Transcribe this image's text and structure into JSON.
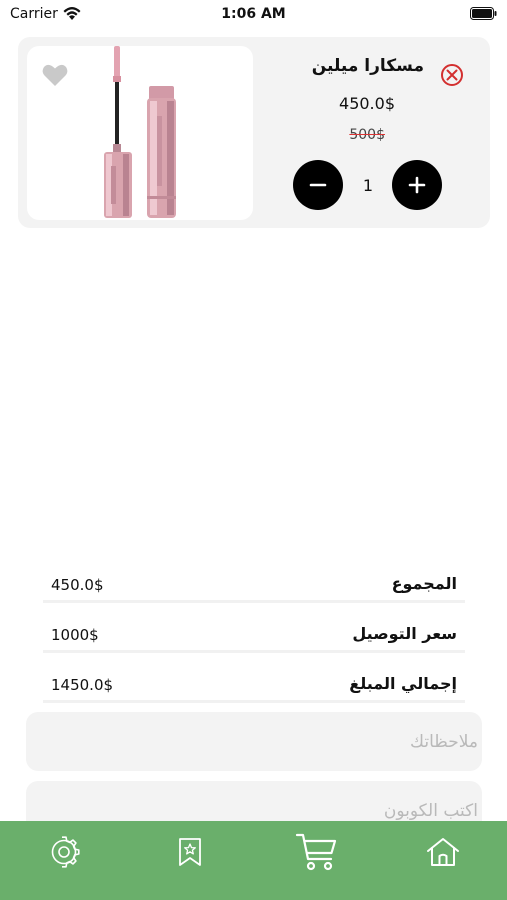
{
  "status_bar": {
    "carrier": "Carrier",
    "time": "1:06 AM"
  },
  "cart_item": {
    "name": "مسكارا ميلين",
    "price": "450.0$",
    "old_price_number": "500",
    "old_price_currency": "$",
    "quantity": "1",
    "favorite": false
  },
  "summary": {
    "subtotal_label": "المجموع",
    "subtotal_value": "450.0$",
    "delivery_label": "سعر التوصيل",
    "delivery_value": "1000$",
    "total_label": "إجمالي المبلغ",
    "total_value": "1450.0$"
  },
  "notes": {
    "placeholder": "ملاحظاتك",
    "value": ""
  },
  "coupon": {
    "placeholder": "اكتب الكوبون",
    "value": ""
  },
  "colors": {
    "nav_bar": "#6aaf6b",
    "remove": "#d32f2f",
    "old_price": "#dd3333",
    "card_bg": "#f3f3f3"
  },
  "bottom_nav": {
    "items": [
      {
        "icon": "gear-icon"
      },
      {
        "icon": "bookmark-star-icon"
      },
      {
        "icon": "cart-icon"
      },
      {
        "icon": "home-icon"
      }
    ]
  }
}
